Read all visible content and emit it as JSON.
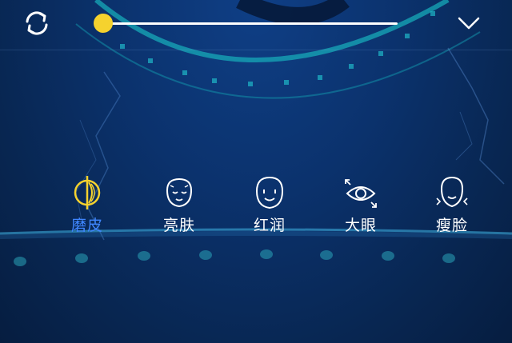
{
  "top_bar": {
    "reset_icon": "refresh-icon",
    "collapse_icon": "chevron-down-icon",
    "slider": {
      "value": 0.0,
      "thumb_color": "#f5d22e",
      "track_color": "#ffffff"
    }
  },
  "tools": {
    "active_color": "#3f86ff",
    "inactive_color": "#ffffff",
    "items": [
      {
        "label": "磨皮",
        "icon": "smooth-skin-icon",
        "active": true
      },
      {
        "label": "亮肤",
        "icon": "brighten-skin-icon",
        "active": false
      },
      {
        "label": "红润",
        "icon": "rosy-face-icon",
        "active": false
      },
      {
        "label": "大眼",
        "icon": "big-eye-icon",
        "active": false
      },
      {
        "label": "瘦脸",
        "icon": "slim-face-icon",
        "active": false
      }
    ]
  }
}
